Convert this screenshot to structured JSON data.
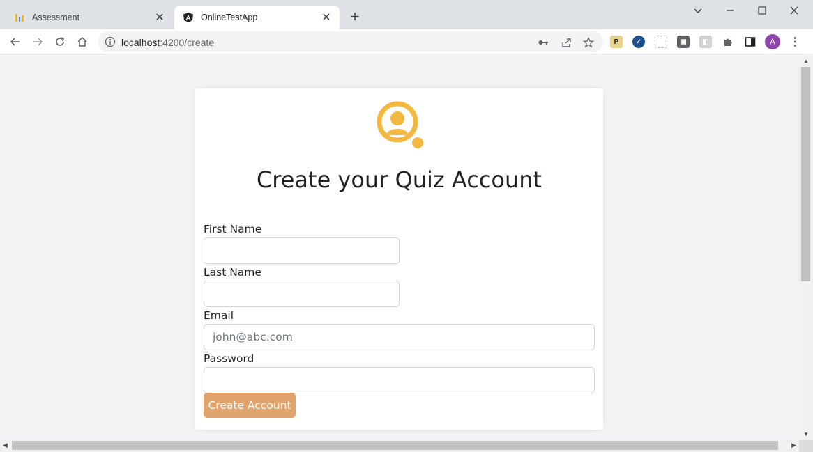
{
  "browser": {
    "tabs": [
      {
        "title": "Assessment",
        "active": false,
        "icon": "bar-chart-favicon"
      },
      {
        "title": "OnlineTestApp",
        "active": true,
        "icon": "angular-favicon"
      }
    ],
    "url": {
      "host": "localhost",
      "path": ":4200/create"
    },
    "profile_initial": "A",
    "extensions": [
      "P"
    ]
  },
  "form": {
    "heading": "Create your Quiz Account",
    "first_name_label": "First Name",
    "first_name_value": "",
    "last_name_label": "Last Name",
    "last_name_value": "",
    "email_label": "Email",
    "email_value": "",
    "email_placeholder": "john@abc.com",
    "password_label": "Password",
    "password_value": "",
    "submit_label": "Create Account"
  },
  "colors": {
    "accent_logo": "#f4b740",
    "button": "#e0a36c",
    "page_bg": "#f1f3f4"
  }
}
